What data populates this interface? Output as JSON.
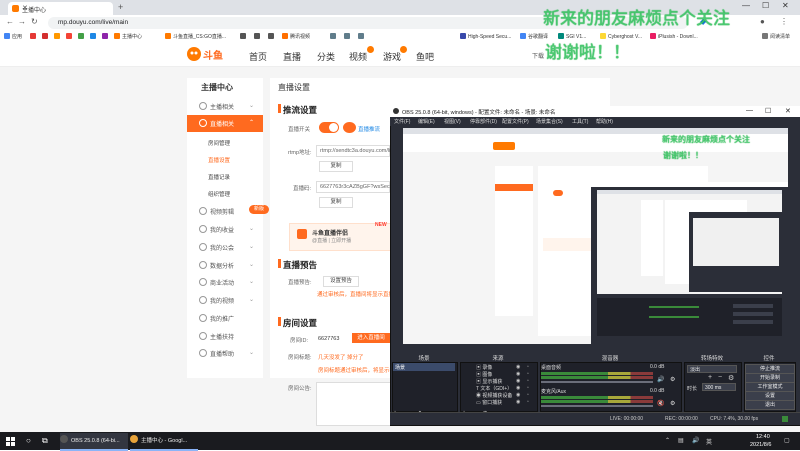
{
  "browser": {
    "tab_title": "主播中心",
    "url": "mp.douyu.com/live/main",
    "bookmarks": [
      "应用",
      "图",
      "图",
      "图",
      "图",
      "图",
      "图",
      "图",
      "主播中心",
      "斗鱼直播_CS:GO直播...",
      "图",
      "图",
      "图",
      "腾讯视频",
      "图",
      "图",
      "图",
      "High-Speed Secu...",
      "谷歌翻译",
      "SGI V1...",
      "Cyberghost V...",
      "iPlusish - Downl...",
      "阅读清单"
    ],
    "other_bookmarks": "阅读清单"
  },
  "douyu": {
    "logo": "斗鱼",
    "nav": [
      "首页",
      "直播",
      "分类",
      "视频",
      "游戏",
      "鱼吧"
    ],
    "download": "下载",
    "sidebar": {
      "title": "主播中心",
      "items": [
        "主播相关",
        "直播相关",
        "视频剪辑",
        "我的收益",
        "我的公会",
        "数据分析",
        "商业活动",
        "我的视频",
        "我的推广",
        "主播扶持",
        "直播帮助"
      ],
      "subs": [
        "房间管理",
        "直播设置",
        "直播记录",
        "组织管理"
      ],
      "new_tag": "新版"
    },
    "main": {
      "page_title": "直播设置",
      "section_stream": "推流设置",
      "switch_label": "直播开关",
      "quick_link": "直播推流",
      "rtmp_label": "rtmp地址:",
      "rtmp_value": "rtmp://sendtc3a.douyu.com/live",
      "copy": "复制",
      "key_label": "直播码:",
      "key_value": "6627763r3cAZBgGF?wsSecret=...",
      "promo_title": "斗鱼直播伴侣",
      "promo_sub": "@直播 | 立即开播",
      "promo_tag": "NEW",
      "section_preview": "直播预告",
      "preview_label": "直播预告:",
      "preview_btn": "设置预告",
      "preview_note": "通过审核后，直播间将显示直播预告",
      "section_room": "房间设置",
      "room_id_label": "房间ID:",
      "room_id": "6627763",
      "room_btn": "进入直播间",
      "room_title_label": "房间标题:",
      "room_title": "几天没发了 掉分了",
      "room_title_note": "房间标题通过审核后，将显示在...",
      "notice_label": "房间公告:"
    }
  },
  "danmaku": [
    "新来的朋友麻烦点个关注",
    "谢谢啦！！",
    "新来的朋友麻烦点个关注",
    "谢谢啦！！"
  ],
  "obs": {
    "title": "OBS 25.0.8 (64-bit, windows) - 配置文件: 未命名 - 场景: 未命名",
    "menu": [
      "文件(F)",
      "编辑(E)",
      "视图(V)",
      "停靠部件(D)",
      "配置文件(P)",
      "场景集合(S)",
      "工具(T)",
      "帮助(H)"
    ],
    "docks": [
      "场景",
      "来源",
      "混音器",
      "转场特效",
      "控件"
    ],
    "scene": "场景",
    "sources": [
      "录像",
      "图像",
      "显示捕获",
      "文本（GDI+）",
      "视频捕获设备",
      "窗口捕获"
    ],
    "mixer": [
      {
        "name": "桌面音频",
        "db": "0.0 dB"
      },
      {
        "name": "麦克风/Aux",
        "db": "0.0 dB"
      }
    ],
    "transition": "淡出",
    "duration_label": "时长",
    "duration": "300 ms",
    "controls": [
      "停止推流",
      "开始录制",
      "工作室模式",
      "设置",
      "退出"
    ],
    "status": {
      "live": "LIVE: 00:00:00",
      "rec": "REC: 00:00:00",
      "cpu": "CPU: 7.4%, 30.00 fps",
      "kb": "kb/s: 2400"
    }
  },
  "taskbar": {
    "apps": [
      "OBS 25.0.8 (64-bi...",
      "主播中心 - Googl..."
    ],
    "time": "12:40",
    "date": "2021/8/6"
  }
}
